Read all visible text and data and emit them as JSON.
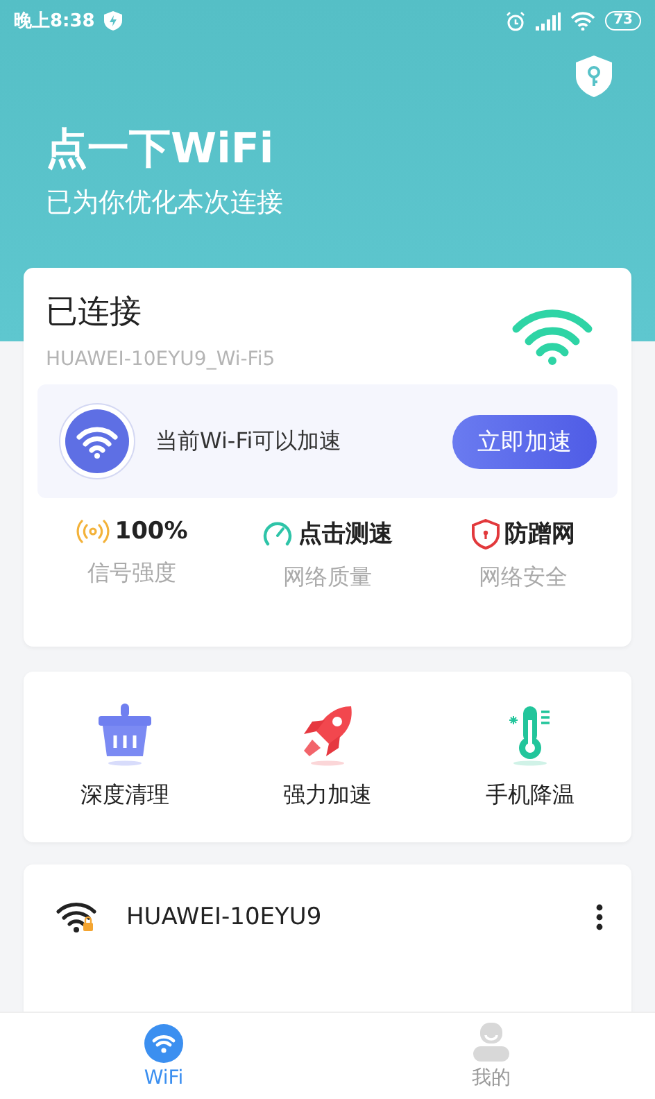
{
  "status_bar": {
    "time": "晚上8:38",
    "battery": "73"
  },
  "header": {
    "title": "点一下WiFi",
    "subtitle": "已为你优化本次连接"
  },
  "connection": {
    "status": "已连接",
    "ssid": "HUAWEI-10EYU9_Wi-Fi5",
    "boost_message": "当前Wi-Fi可以加速",
    "boost_button": "立即加速",
    "stats": [
      {
        "kind": "signal",
        "value": "100%",
        "label": "信号强度"
      },
      {
        "kind": "speed",
        "value": "点击测速",
        "label": "网络质量"
      },
      {
        "kind": "security",
        "value": "防蹭网",
        "label": "网络安全"
      }
    ]
  },
  "tools": [
    {
      "kind": "clean",
      "label": "深度清理"
    },
    {
      "kind": "boost",
      "label": "强力加速"
    },
    {
      "kind": "cool",
      "label": "手机降温"
    }
  ],
  "networks": [
    {
      "name": "HUAWEI-10EYU9",
      "locked": true
    }
  ],
  "tabs": [
    {
      "kind": "wifi",
      "label": "WiFi",
      "selected": true
    },
    {
      "kind": "me",
      "label": "我的",
      "selected": false
    }
  ]
}
